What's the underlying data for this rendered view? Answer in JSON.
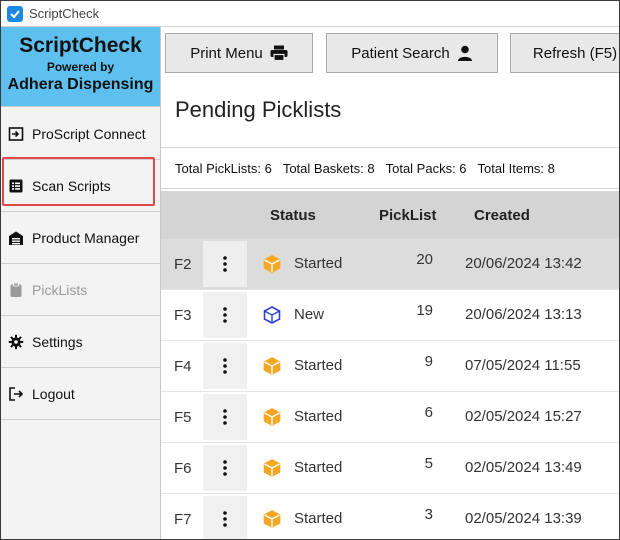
{
  "window": {
    "title": "ScriptCheck"
  },
  "brand": {
    "name": "ScriptCheck",
    "powered_by": "Powered by",
    "company": "Adhera Dispensing"
  },
  "sidebar": {
    "items": [
      {
        "label": "ProScript Connect",
        "icon": "sign-in-icon",
        "disabled": false
      },
      {
        "label": "Scan Scripts",
        "icon": "list-icon",
        "disabled": false,
        "highlighted": true
      },
      {
        "label": "Product Manager",
        "icon": "warehouse-icon",
        "disabled": false
      },
      {
        "label": "PickLists",
        "icon": "clipboard-icon",
        "disabled": true
      },
      {
        "label": "Settings",
        "icon": "gear-icon",
        "disabled": false
      },
      {
        "label": "Logout",
        "icon": "logout-icon",
        "disabled": false
      }
    ]
  },
  "toolbar": {
    "print_label": "Print Menu",
    "patient_search_label": "Patient Search",
    "refresh_label": "Refresh (F5)"
  },
  "main": {
    "title": "Pending Picklists",
    "summary": {
      "picklists": "Total PickLists: 6",
      "baskets": "Total Baskets: 8",
      "packs": "Total Packs: 6",
      "items": "Total Items: 8"
    }
  },
  "table": {
    "columns": {
      "status": "Status",
      "picklist": "PickList",
      "created": "Created"
    },
    "rows": [
      {
        "key": "F2",
        "status": "Started",
        "status_color": "#f5a623",
        "picklist": "20",
        "created": "20/06/2024 13:42",
        "selected": true
      },
      {
        "key": "F3",
        "status": "New",
        "status_color": "#2b3fd6",
        "picklist": "19",
        "created": "20/06/2024 13:13",
        "selected": false
      },
      {
        "key": "F4",
        "status": "Started",
        "status_color": "#f5a623",
        "picklist": "9",
        "created": "07/05/2024 11:55",
        "selected": false
      },
      {
        "key": "F5",
        "status": "Started",
        "status_color": "#f5a623",
        "picklist": "6",
        "created": "02/05/2024 15:27",
        "selected": false
      },
      {
        "key": "F6",
        "status": "Started",
        "status_color": "#f5a623",
        "picklist": "5",
        "created": "02/05/2024 13:49",
        "selected": false
      },
      {
        "key": "F7",
        "status": "Started",
        "status_color": "#f5a623",
        "picklist": "3",
        "created": "02/05/2024 13:39",
        "selected": false
      }
    ]
  },
  "colors": {
    "brand_bg": "#5ec0ef",
    "highlight": "#e0484b",
    "header_bg": "#d4d4d4"
  }
}
